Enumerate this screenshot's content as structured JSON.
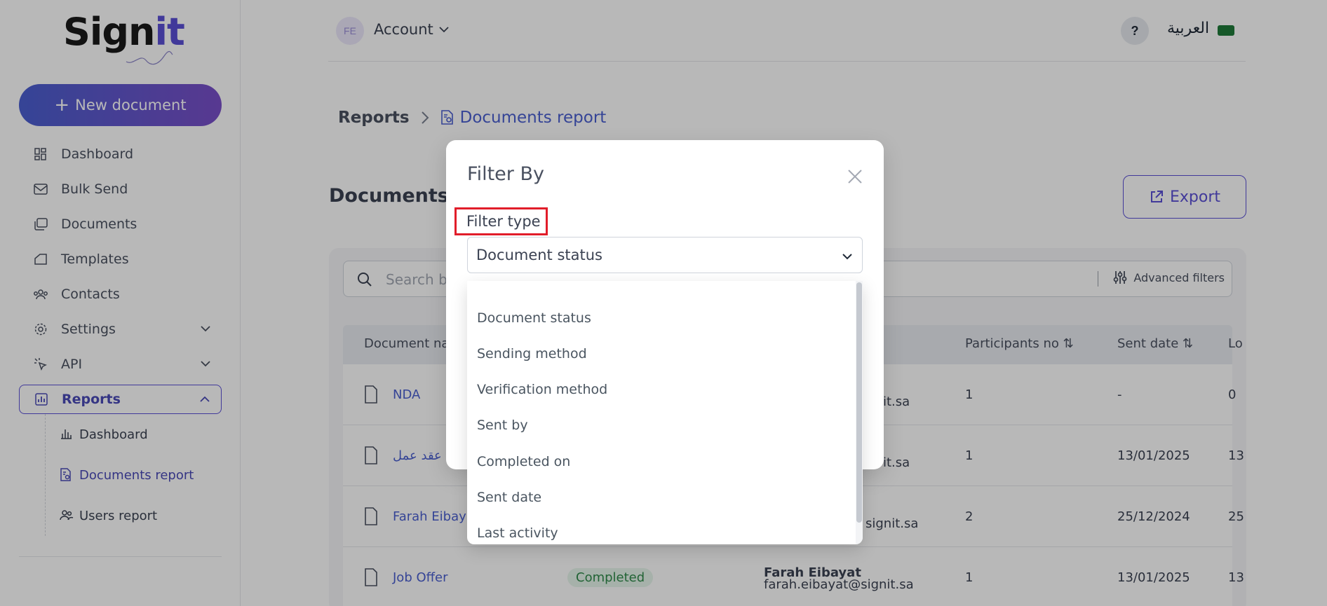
{
  "brand": {
    "logo_main": "Sign",
    "logo_accent": "it"
  },
  "sidebar": {
    "new_document": "New document",
    "items": [
      {
        "label": "Dashboard"
      },
      {
        "label": "Bulk Send"
      },
      {
        "label": "Documents"
      },
      {
        "label": "Templates"
      },
      {
        "label": "Contacts"
      },
      {
        "label": "Settings"
      },
      {
        "label": "API"
      },
      {
        "label": "Reports"
      }
    ],
    "sub_items": [
      {
        "label": "Dashboard"
      },
      {
        "label": "Documents report"
      },
      {
        "label": "Users report"
      }
    ]
  },
  "topbar": {
    "avatar_initials": "FE",
    "account_label": "Account",
    "help_label": "?",
    "language": "العربية"
  },
  "breadcrumb": {
    "root": "Reports",
    "current": "Documents report"
  },
  "page": {
    "title": "Documents r",
    "export_label": "Export"
  },
  "search": {
    "placeholder": "Search b",
    "advanced_filters": "Advanced filters"
  },
  "table": {
    "columns": {
      "name": "Document na",
      "participants": "Participants no",
      "sent": "Sent date",
      "last": "Lo"
    },
    "rows": [
      {
        "name": "NDA",
        "email": "it.sa",
        "participants": "1",
        "sent": "-",
        "last": "0"
      },
      {
        "name": "عقد عمل",
        "email": "it.sa",
        "participants": "1",
        "sent": "13/01/2025",
        "last": "13"
      },
      {
        "name": "Farah Eibay",
        "email": "signit.sa",
        "participants": "2",
        "sent": "25/12/2024",
        "last": "25"
      },
      {
        "name": "Job Offer",
        "status": "Completed",
        "sender": "Farah Eibayat",
        "email": "farah.eibayat@signit.sa",
        "participants": "1",
        "sent": "13/01/2025",
        "last": "13"
      }
    ]
  },
  "modal": {
    "title": "Filter By",
    "filter_type_label": "Filter type",
    "selected": "Document status",
    "options": [
      "Document status",
      "Sending method",
      "Verification method",
      "Sent by",
      "Completed on",
      "Sent date",
      "Last activity"
    ]
  }
}
